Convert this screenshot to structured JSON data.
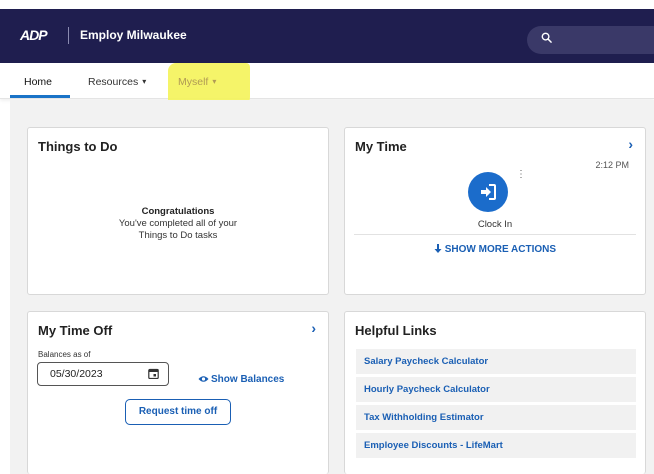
{
  "header": {
    "logo_text": "ADP",
    "company_name": "Employ Milwaukee",
    "search_icon": "search-icon",
    "background_color": "#1f1e4f"
  },
  "nav": {
    "tabs": [
      {
        "label": "Home",
        "active": true
      },
      {
        "label": "Resources",
        "caret": "▾"
      },
      {
        "label": "Myself",
        "caret": "▾"
      }
    ],
    "highlight_color": "#f4f35c"
  },
  "cards": {
    "things_to_do": {
      "title": "Things to Do",
      "message_heading": "Congratulations",
      "message_line1": "You've completed all of your",
      "message_line2": "Things to Do tasks"
    },
    "my_time": {
      "title": "My Time",
      "chevron": "›",
      "time": "2:12 PM",
      "clock_in_label": "Clock In",
      "show_more": "SHOW MORE ACTIONS",
      "more_icon": "⋮"
    },
    "my_time_off": {
      "title": "My Time Off",
      "chevron": "›",
      "balances_label": "Balances as of",
      "date_value": "05/30/2023",
      "show_balances": "Show Balances",
      "request_button": "Request time off"
    },
    "helpful_links": {
      "title": "Helpful Links",
      "links": [
        "Salary Paycheck Calculator",
        "Hourly Paycheck Calculator",
        "Tax Withholding Estimator",
        "Employee Discounts - LifeMart"
      ]
    }
  },
  "colors": {
    "accent": "#1a5fb4",
    "clock_button": "#1b6ccb"
  }
}
